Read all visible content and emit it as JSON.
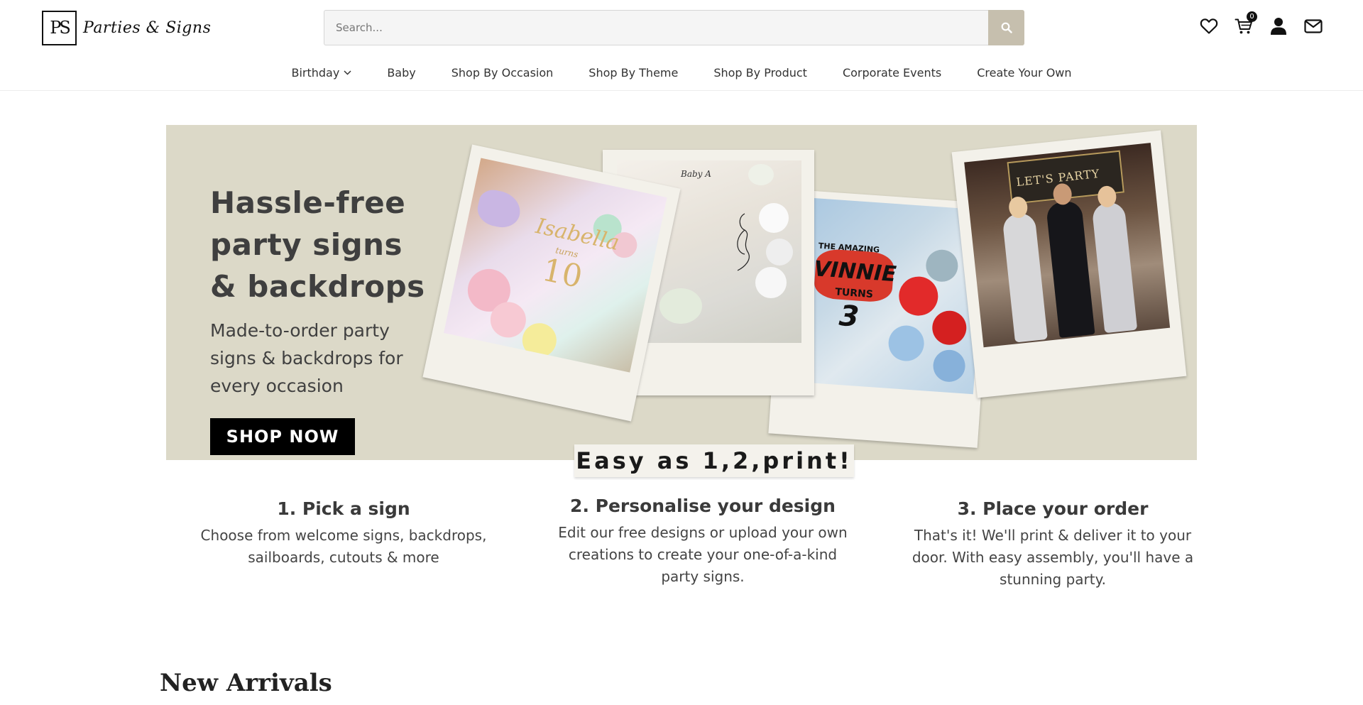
{
  "header": {
    "logo_mark": "PS",
    "logo_text": "Parties & Signs",
    "search": {
      "placeholder": "Search..."
    },
    "cart_count": "0",
    "icons": [
      "heart-icon",
      "cart-icon",
      "user-icon",
      "mail-icon"
    ]
  },
  "nav": {
    "items": [
      {
        "label": "Birthday",
        "has_dropdown": true
      },
      {
        "label": "Baby"
      },
      {
        "label": "Shop By Occasion"
      },
      {
        "label": "Shop By Theme"
      },
      {
        "label": "Shop By Product"
      },
      {
        "label": "Corporate Events"
      },
      {
        "label": "Create Your Own"
      }
    ]
  },
  "hero": {
    "title_line1": "Hassle-free",
    "title_line2": "party signs",
    "title_line3": "& backdrops",
    "subtitle": "Made-to-order party signs & backdrops for every occasion",
    "cta": "SHOP NOW",
    "photo1_text": "Isabella",
    "photo1_sub": "turns",
    "photo1_num": "10",
    "photo2_text": "Baby A",
    "photo3_line1": "THE AMAZING",
    "photo3_line2": "VINNIE",
    "photo3_line3": "TURNS",
    "photo3_num": "3",
    "photo4_text": "LET'S PARTY"
  },
  "easy": {
    "label": "Easy as 1,2,print!"
  },
  "steps": [
    {
      "title": "1.  Pick a sign",
      "text": "Choose from welcome signs, backdrops, sailboards, cutouts & more"
    },
    {
      "title": "2. Personalise your design",
      "text": "Edit our free designs or upload your own creations to create your one-of-a-kind party signs."
    },
    {
      "title": "3. Place your order",
      "text": "That's it! We'll print & deliver it to your door. With easy assembly, you'll have a stunning party."
    }
  ],
  "section": {
    "new_arrivals": "New Arrivals"
  },
  "colors": {
    "accent": "#c6bfae",
    "hero_bg": "#dcd9c8",
    "cta_bg": "#000000"
  }
}
